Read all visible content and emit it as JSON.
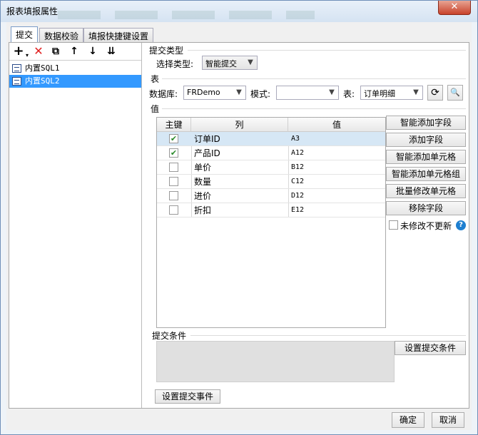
{
  "window": {
    "title": "报表填报属性",
    "close_glyph": "✕"
  },
  "tabs": [
    "提交",
    "数据校验",
    "填报快捷键设置"
  ],
  "toolbar": {
    "icons": [
      "add-icon",
      "delete-icon",
      "copy-icon",
      "move-up-icon",
      "move-down-icon",
      "move-bottom-icon"
    ],
    "glyphs": [
      "+",
      "✕",
      "⧉",
      "↑",
      "↓",
      "⇊"
    ]
  },
  "sql_list": [
    {
      "label": "内置SQL1",
      "selected": false
    },
    {
      "label": "内置SQL2",
      "selected": true
    }
  ],
  "submit_type": {
    "section_label": "提交类型",
    "field_label": "选择类型:",
    "value": "智能提交"
  },
  "table_section": {
    "section_label": "表",
    "database_label": "数据库:",
    "database_value": "FRDemo",
    "mode_label": "模式:",
    "mode_value": "",
    "table_label": "表:",
    "table_value": "订单明细"
  },
  "values_section": {
    "section_label": "值",
    "columns": [
      "主键",
      "列",
      "值"
    ],
    "rows": [
      {
        "key": true,
        "column": "订单ID",
        "value": "A3",
        "selected": true
      },
      {
        "key": true,
        "column": "产品ID",
        "value": "A12",
        "selected": false
      },
      {
        "key": false,
        "column": "单价",
        "value": "B12",
        "selected": false
      },
      {
        "key": false,
        "column": "数量",
        "value": "C12",
        "selected": false
      },
      {
        "key": false,
        "column": "进价",
        "value": "D12",
        "selected": false
      },
      {
        "key": false,
        "column": "折扣",
        "value": "E12",
        "selected": false
      }
    ],
    "buttons": [
      "智能添加字段",
      "添加字段",
      "智能添加单元格",
      "智能添加单元格组",
      "批量修改单元格",
      "移除字段"
    ],
    "no_update_label": "未修改不更新",
    "no_update_checked": false
  },
  "condition": {
    "section_label": "提交条件",
    "set_button": "设置提交条件"
  },
  "event_button": "设置提交事件",
  "footer": {
    "ok": "确定",
    "cancel": "取消"
  },
  "colors": {
    "selected": "#3399ff",
    "row_highlight": "#d6e7f5",
    "help": "#1e7fd0",
    "delete": "#e02020"
  }
}
